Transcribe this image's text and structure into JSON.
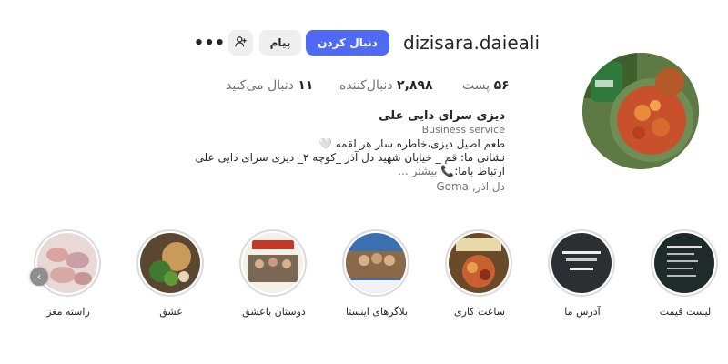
{
  "profile": {
    "username": "dizisara.daieali",
    "follow_label": "دنبال کردن",
    "message_label": "پیام",
    "suggest_icon": "person-add-icon",
    "more_label": "•••"
  },
  "stats": {
    "posts_count": "۵۶",
    "posts_label": "پست",
    "followers_count": "۲,۸۹۸",
    "followers_label": "دنبال‌کننده",
    "following_count": "۱۱",
    "following_label": "دنبال می‌کنید"
  },
  "bio": {
    "name": "دیزی سرای دایی علی",
    "category": "Business service",
    "line1": "طعم اصیل دیزی،خاطره ساز هر لقمه 🤍",
    "line2": "نشانی ما: قم _ خیابان شهید دل آذر _کوچه ۲_ دیزی سرای دایی علی",
    "line3_text": "ارتباط باما:📞",
    "line3_more": "بیشتر ...",
    "location": "دل اذر, Goma"
  },
  "highlights": [
    {
      "label": "لیست قیمت",
      "icon": "menu-board-icon"
    },
    {
      "label": "آدرس ما",
      "icon": "address-card-icon"
    },
    {
      "label": "ساعت کاری",
      "icon": "food-plate-icon"
    },
    {
      "label": "بلاگرهای اینستا",
      "icon": "group-photo-icon"
    },
    {
      "label": "دوستان باعشق",
      "icon": "friends-photo-icon"
    },
    {
      "label": "عشق",
      "icon": "bread-herbs-icon"
    },
    {
      "label": "راسته مغز",
      "icon": "raw-meat-icon"
    }
  ],
  "colors": {
    "follow_button": "#4f6bf5",
    "secondary_button": "#efefef",
    "muted_text": "#737373",
    "highlight_ring": "#dbdbdb"
  }
}
